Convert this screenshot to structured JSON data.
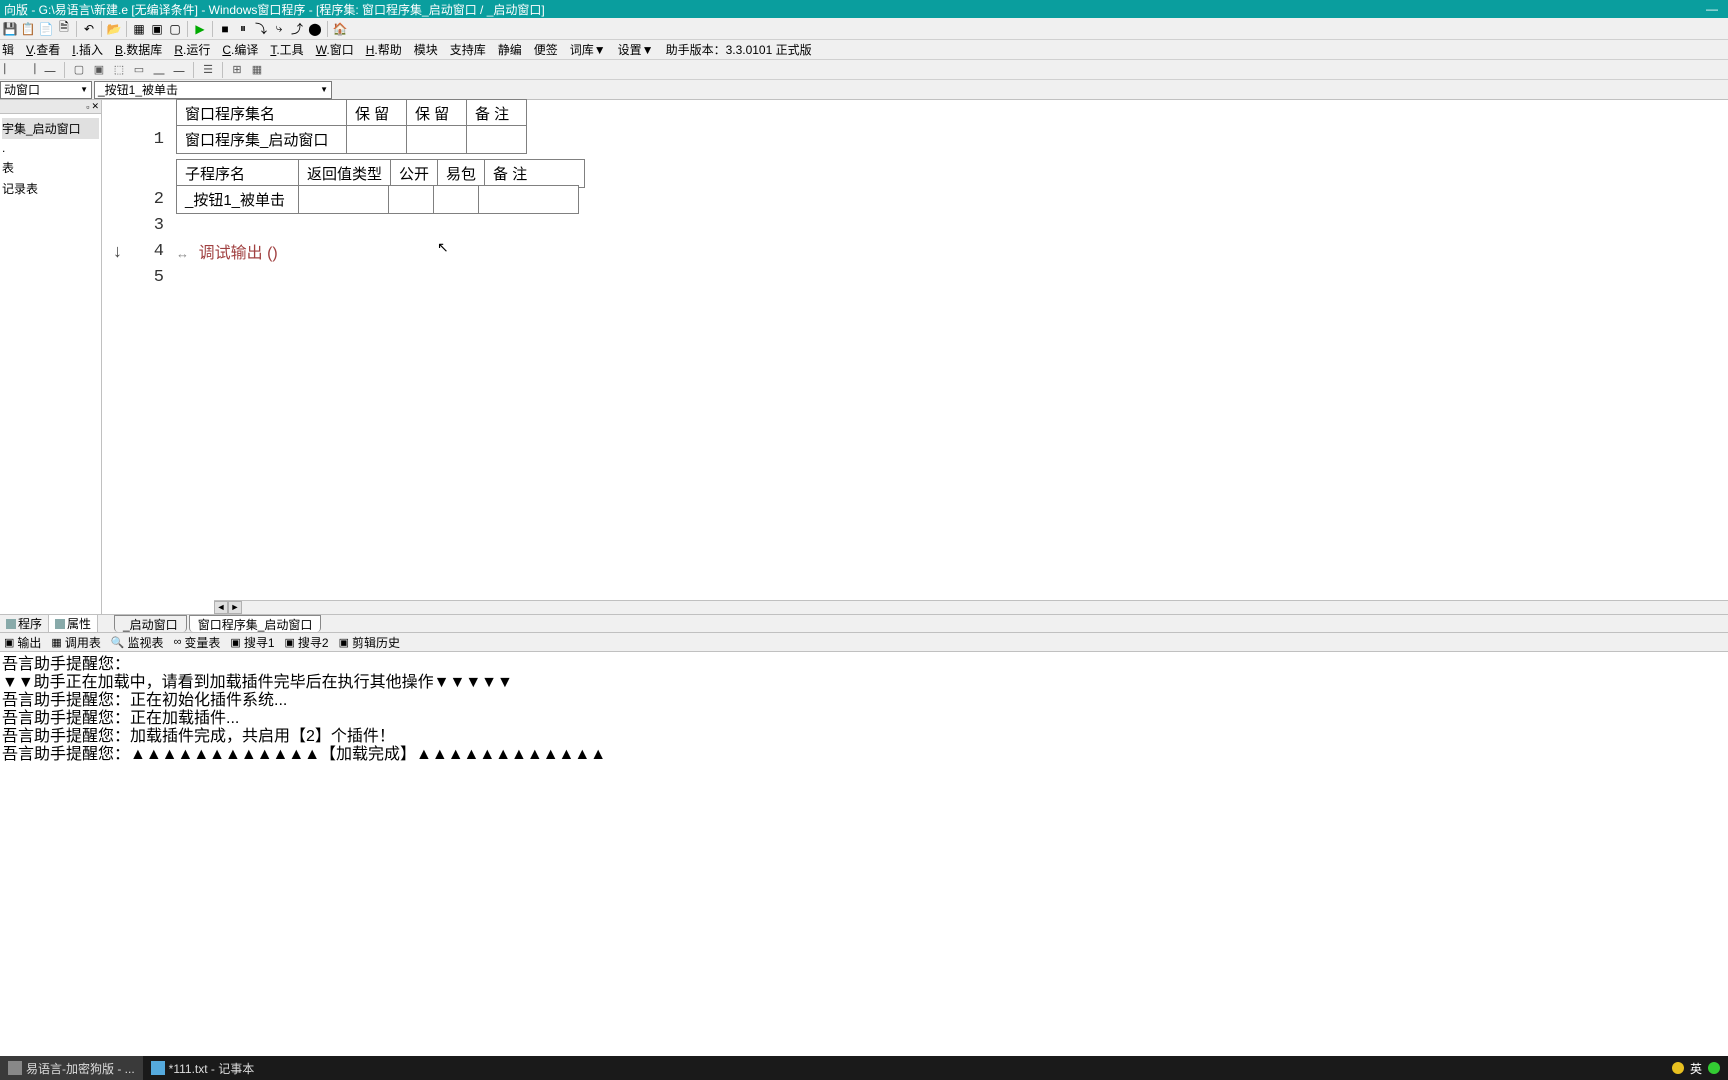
{
  "titlebar": {
    "text": "向版 - G:\\易语言\\新建.e [无编译条件] - Windows窗口程序 - [程序集: 窗口程序集_启动窗口 / _启动窗口]"
  },
  "toolbar1_icons": [
    "💾",
    "📋",
    "📄",
    "🗎",
    "↶",
    "",
    "📂",
    "",
    "▦",
    "▣",
    "▢",
    "",
    "▶",
    "",
    "■",
    "⏸",
    "⏭",
    "⏮",
    "⏯",
    "⏹",
    "⬤",
    "",
    "🏠"
  ],
  "menu": {
    "items": [
      {
        "u": "",
        "t": "辑"
      },
      {
        "u": "V",
        "t": ".查看"
      },
      {
        "u": "I",
        "t": ".插入"
      },
      {
        "u": "B",
        "t": ".数据库"
      },
      {
        "u": "R",
        "t": ".运行"
      },
      {
        "u": "C",
        "t": ".编译"
      },
      {
        "u": "T",
        "t": ".工具"
      },
      {
        "u": "W",
        "t": ".窗口"
      },
      {
        "u": "H",
        "t": ".帮助"
      },
      {
        "u": "",
        "t": "模块"
      },
      {
        "u": "",
        "t": "支持库"
      },
      {
        "u": "",
        "t": "静编"
      },
      {
        "u": "",
        "t": "便签"
      },
      {
        "u": "",
        "t": "词库▼"
      },
      {
        "u": "",
        "t": "设置▼"
      },
      {
        "u": "",
        "t": "助手版本：3.3.0101 正式版"
      }
    ]
  },
  "toolbar2_icons": [
    "⎸",
    "⎹",
    "⎺",
    "",
    "▢",
    "▣",
    "⬚",
    "▭",
    "⎽",
    "⎼",
    "",
    "☰",
    "",
    "⊞",
    "▦"
  ],
  "combos": {
    "c1": "动窗口",
    "c2": "_按钮1_被单击"
  },
  "sidebar": {
    "items": [
      {
        "label": "宇集_启动窗口",
        "sel": true
      },
      {
        "label": "."
      },
      {
        "label": "表"
      },
      {
        "label": "记录表"
      }
    ],
    "tabs": [
      {
        "label": "程序",
        "active": false
      },
      {
        "label": "属性",
        "active": true
      }
    ]
  },
  "code": {
    "table1": {
      "headers": [
        "窗口程序集名",
        "保  留",
        "保  留",
        "备  注"
      ],
      "row": [
        "窗口程序集_启动窗口",
        "",
        "",
        ""
      ]
    },
    "table2": {
      "headers": [
        "子程序名",
        "返回值类型",
        "公开",
        "易包",
        "备  注"
      ],
      "row": [
        "_按钮1_被单击",
        "",
        "",
        "",
        ""
      ]
    },
    "line4_prefix": "↔",
    "line4_text": "调试输出 ()",
    "marker": "↓",
    "lines": [
      "1",
      "2",
      "3",
      "4",
      "5"
    ]
  },
  "editor_tabs": [
    {
      "label": "_启动窗口",
      "active": false
    },
    {
      "label": "窗口程序集_启动窗口",
      "active": true
    }
  ],
  "output_tabs": [
    {
      "icon": "▣",
      "label": "输出"
    },
    {
      "icon": "▦",
      "label": "调用表"
    },
    {
      "icon": "🔍",
      "label": "监视表"
    },
    {
      "icon": "∞",
      "label": "变量表"
    },
    {
      "icon": "▣",
      "label": "搜寻1"
    },
    {
      "icon": "▣",
      "label": "搜寻2"
    },
    {
      "icon": "▣",
      "label": "剪辑历史"
    }
  ],
  "output_lines": [
    "吾言助手提醒您：",
    "▼▼助手正在加载中，请看到加载插件完毕后在执行其他操作▼▼▼▼▼",
    "吾言助手提醒您：正在初始化插件系统...",
    "吾言助手提醒您：正在加载插件...",
    "吾言助手提醒您：加载插件完成，共启用【2】个插件！",
    "吾言助手提醒您：▲▲▲▲▲▲▲▲▲▲▲▲【加载完成】▲▲▲▲▲▲▲▲▲▲▲▲"
  ],
  "taskbar": {
    "items": [
      {
        "label": "易语言-加密狗版 - ..."
      },
      {
        "label": "*111.txt - 记事本"
      }
    ],
    "tray_lang": "英"
  }
}
